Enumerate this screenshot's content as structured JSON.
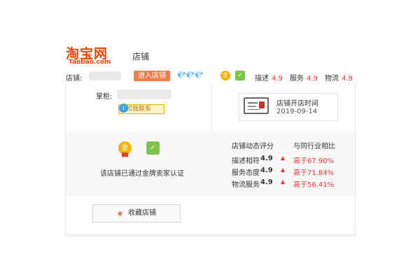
{
  "header": {
    "logo_cn": "淘宝网",
    "logo_en": "Taobao.com",
    "title": "店铺"
  },
  "shop_bar": {
    "shop_label": "店铺:",
    "enter_button": "进入店铺",
    "diamonds": "💎💎💎",
    "gold_badge_glyph": "金",
    "green_badge_glyph": "✓",
    "scores": [
      {
        "label": "描述",
        "value": "4.9"
      },
      {
        "label": "服务",
        "value": "4.9"
      },
      {
        "label": "物流",
        "value": "4.9"
      }
    ]
  },
  "seller": {
    "label": "掌柜:",
    "contact_button": "和我联系",
    "contact_icon_glyph": "i"
  },
  "open_time": {
    "label": "店铺开店时间",
    "value": "2019-09-14"
  },
  "certification": {
    "gold_glyph": "金",
    "green_glyph": "✓",
    "text": "该店铺已通过金牌卖家认证"
  },
  "ratings": {
    "title": "店铺动态评分",
    "compare_title": "与同行业相比",
    "arrow_glyph": "▲",
    "rows": [
      {
        "label": "描述相符",
        "value": "4.9",
        "compare": "高于67.90%"
      },
      {
        "label": "服务态度",
        "value": "4.9",
        "compare": "高于71.84%"
      },
      {
        "label": "物流服务",
        "value": "4.9",
        "compare": "高于56.41%"
      }
    ]
  },
  "favorite": {
    "star_glyph": "★",
    "label": "收藏店铺"
  },
  "colors": {
    "brand": "#ff4400",
    "enter_button": "#f57d4d",
    "score_red": "#e4393c",
    "diamond_blue": "#1aa2e8",
    "gold": "#f6b200",
    "green": "#7ec34a"
  },
  "icons": {
    "diamond": "diamond-icon",
    "gold_medal": "gold-medal-icon",
    "green_badge": "verified-badge-icon",
    "id_card": "id-card-icon",
    "star": "star-icon",
    "arrow_up": "arrow-up-icon",
    "contact": "chat-icon"
  }
}
